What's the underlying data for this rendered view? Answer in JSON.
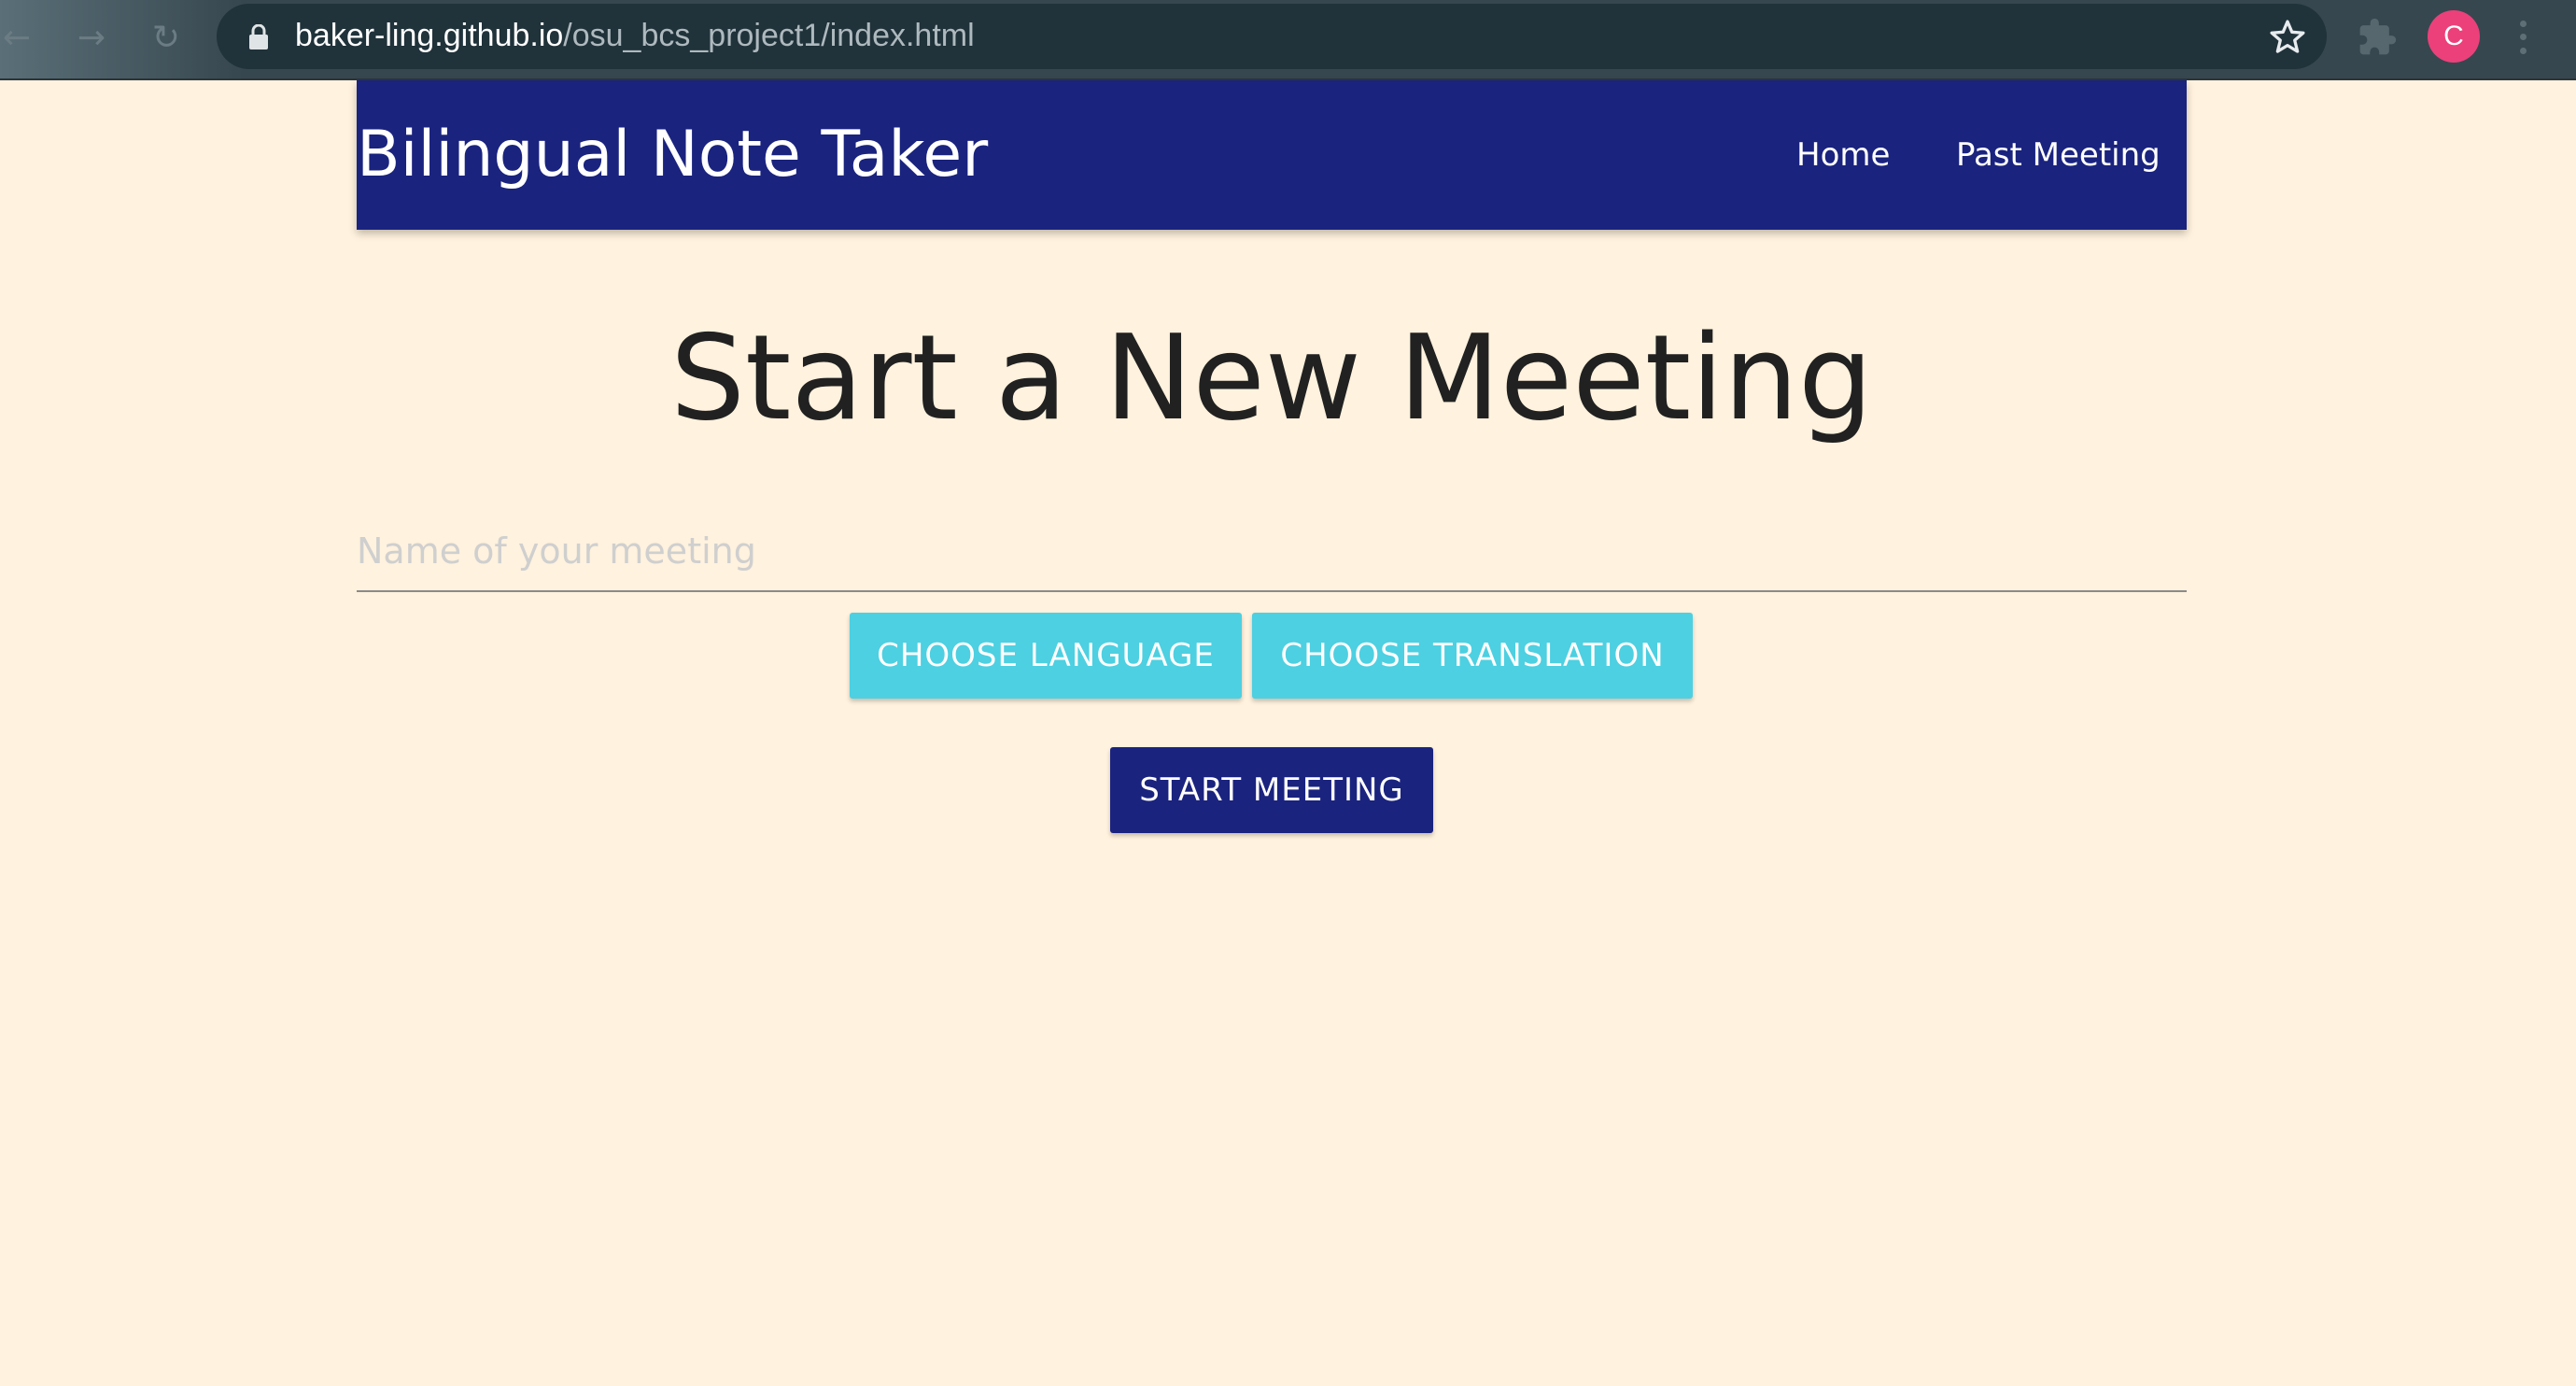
{
  "browser": {
    "url_host": "baker-ling.github.io",
    "url_path": "/osu_bcs_project1/index.html",
    "profile_initial": "C",
    "back_icon": "←",
    "forward_icon": "→",
    "reload_icon": "↻"
  },
  "navbar": {
    "brand": "Bilingual Note Taker",
    "links": [
      {
        "label": "Home"
      },
      {
        "label": "Past Meeting"
      }
    ],
    "color": "#1a237e"
  },
  "main": {
    "title": "Start a New Meeting",
    "meeting_name_placeholder": "Name of your meeting",
    "meeting_name_value": "",
    "choose_language_label": "Choose Language",
    "choose_translation_label": "Choose Translation",
    "start_meeting_label": "Start Meeting"
  },
  "colors": {
    "page_background": "#fff2de",
    "accent_button": "#4dd0e1",
    "primary_button": "#1a237e"
  }
}
